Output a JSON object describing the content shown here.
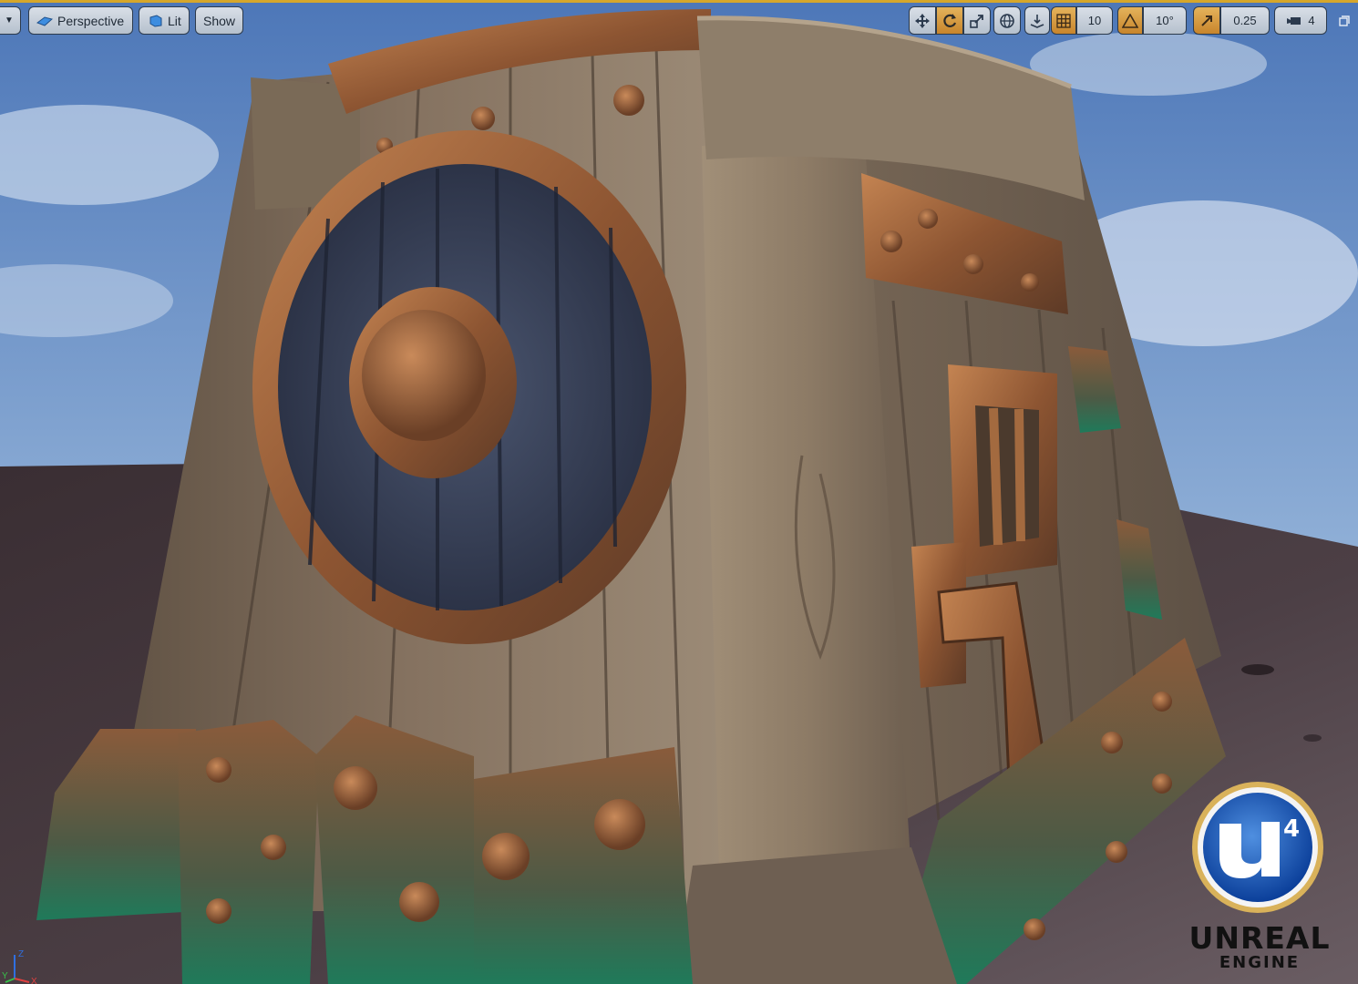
{
  "toolbar": {
    "menu_icon": "chevron-down-icon",
    "view_mode": "Perspective",
    "view_mode_icon": "perspective-cube-icon",
    "lighting": "Lit",
    "lighting_icon": "lit-sphere-icon",
    "show": "Show"
  },
  "transform_tools": {
    "translate_icon": "move-arrows-icon",
    "rotate_icon": "rotate-icon",
    "scale_icon": "scale-icon",
    "world_local_icon": "globe-icon",
    "surface_snap_icon": "surface-snap-icon",
    "grid_snap_icon": "grid-icon",
    "grid_snap_value": "10",
    "rotation_snap_icon": "angle-icon",
    "rotation_snap_value": "10°",
    "scale_snap_icon": "scale-snap-icon",
    "scale_snap_value": "0.25",
    "camera_speed_icon": "camera-speed-icon",
    "camera_speed_value": "4",
    "maximize_icon": "maximize-icon"
  },
  "logo": {
    "emblem": "U4",
    "name": "UNREAL",
    "sub": "ENGINE"
  },
  "axes": {
    "z": "Z",
    "x": "X",
    "y": "Y"
  },
  "colors": {
    "accent_active": "#d88f35",
    "sky": "#6f8fbf",
    "ground": "#4a3b3f",
    "wood": "#8a7761",
    "copper": "#a9683d",
    "patina": "#2f8a6a"
  }
}
